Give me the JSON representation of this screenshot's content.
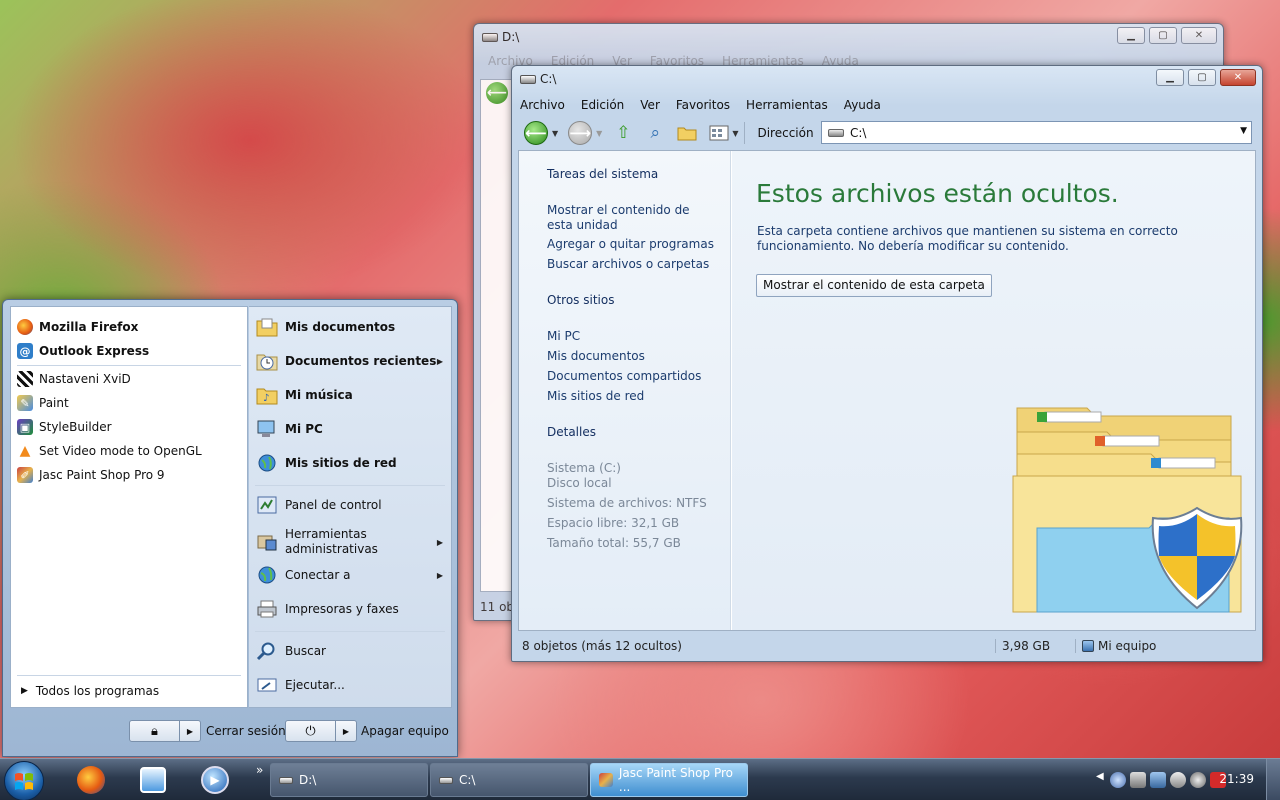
{
  "window_back": {
    "title": "D:\\",
    "menu": [
      "Archivo",
      "Edición",
      "Ver",
      "Favoritos",
      "Herramientas",
      "Ayuda"
    ],
    "status": "11 ob"
  },
  "window_front": {
    "title": "C:\\",
    "menu": [
      "Archivo",
      "Edición",
      "Ver",
      "Favoritos",
      "Herramientas",
      "Ayuda"
    ],
    "address_label": "Dirección",
    "address_value": "C:\\",
    "tasks": {
      "system_header": "Tareas del sistema",
      "show_drive_contents": "Mostrar el contenido de esta unidad",
      "add_remove": "Agregar o quitar programas",
      "search_files": "Buscar archivos o carpetas",
      "other_places_header": "Otros sitios",
      "my_pc": "Mi PC",
      "my_documents": "Mis documentos",
      "shared_documents": "Documentos compartidos",
      "network_places": "Mis sitios de red",
      "details_header": "Detalles",
      "drive_name": "Sistema (C:)",
      "drive_type": "Disco local",
      "file_system": "Sistema de archivos: NTFS",
      "free_space": "Espacio libre: 32,1 GB",
      "total_size": "Tamaño total: 55,7 GB"
    },
    "hidden_title": "Estos archivos están ocultos.",
    "hidden_desc": "Esta carpeta contiene archivos que mantienen su sistema en correcto funcionamiento. No debería modificar su contenido.",
    "show_button": "Mostrar el contenido de esta carpeta",
    "status": {
      "objects": "8 objetos (más 12 ocultos)",
      "size": "3,98 GB",
      "location": "Mi equipo"
    }
  },
  "start_menu": {
    "pinned": [
      "Mozilla Firefox",
      "Outlook Express"
    ],
    "recent": [
      "Nastaveni XviD",
      "Paint",
      "StyleBuilder",
      "Set Video mode to OpenGL",
      "Jasc Paint Shop Pro 9"
    ],
    "all_programs": "Todos los programas",
    "right": {
      "my_documents": "Mis documentos",
      "recent_documents": "Documentos recientes",
      "my_music": "Mi música",
      "my_pc": "Mi PC",
      "network_places": "Mis sitios de red",
      "control_panel": "Panel de control",
      "admin_tools": "Herramientas administrativas",
      "connect_to": "Conectar a",
      "printers": "Impresoras y faxes",
      "search": "Buscar",
      "run": "Ejecutar..."
    },
    "logoff": "Cerrar sesión",
    "shutdown": "Apagar equipo"
  },
  "taskbar": {
    "overflow": "»",
    "buttons": [
      "D:\\",
      "C:\\",
      "Jasc Paint Shop Pro ..."
    ],
    "clock": "21:39"
  },
  "colors": {
    "accent_title_green": "#2a7a3a",
    "link_blue": "#1c3c6e",
    "taskbar_active": "#3f8ed0"
  }
}
